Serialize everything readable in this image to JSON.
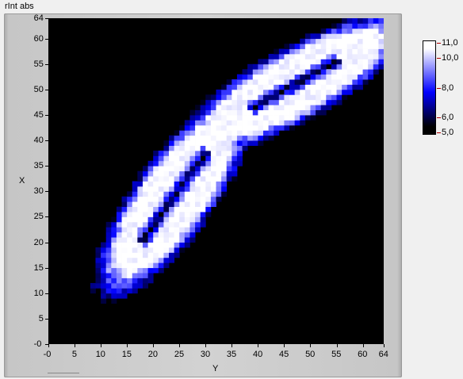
{
  "window": {
    "title": "rInt  abs"
  },
  "colors": {
    "background": "#000000",
    "colormap": [
      "#000000",
      "#0000ff",
      "#ffffff"
    ]
  },
  "chart_data": {
    "type": "heatmap",
    "xlabel": "Y",
    "ylabel": "X",
    "xlim": [
      0,
      64
    ],
    "ylim": [
      0,
      64
    ],
    "x_ticks": [
      "-0",
      "5",
      "10",
      "15",
      "20",
      "25",
      "30",
      "35",
      "40",
      "45",
      "50",
      "55",
      "60",
      "64"
    ],
    "x_tick_values": [
      0,
      5,
      10,
      15,
      20,
      25,
      30,
      35,
      40,
      45,
      50,
      55,
      60,
      64
    ],
    "y_ticks": [
      "-0",
      "5",
      "10",
      "15",
      "20",
      "25",
      "30",
      "35",
      "40",
      "45",
      "50",
      "55",
      "60",
      "64"
    ],
    "y_tick_values": [
      0,
      5,
      10,
      15,
      20,
      25,
      30,
      35,
      40,
      45,
      50,
      55,
      60,
      64
    ],
    "colorbar": {
      "min": 5.0,
      "max": 11.0,
      "ticks": [
        "11,0",
        "10,0",
        "8,0",
        "6,0",
        "5,0"
      ],
      "tick_values": [
        11.0,
        10.0,
        8.0,
        6.0,
        5.0
      ]
    },
    "blobs": [
      {
        "cx": 47,
        "cy": 51,
        "rx": 23.5,
        "ry": 6.8,
        "angle_deg": 30,
        "slit_len": 10,
        "slit_w": 1.6,
        "peak": 11.0
      },
      {
        "cx": 24,
        "cy": 29,
        "rx": 22.5,
        "ry": 7.2,
        "angle_deg": 55,
        "slit_len": 11,
        "slit_w": 1.7,
        "peak": 11.0
      }
    ]
  }
}
